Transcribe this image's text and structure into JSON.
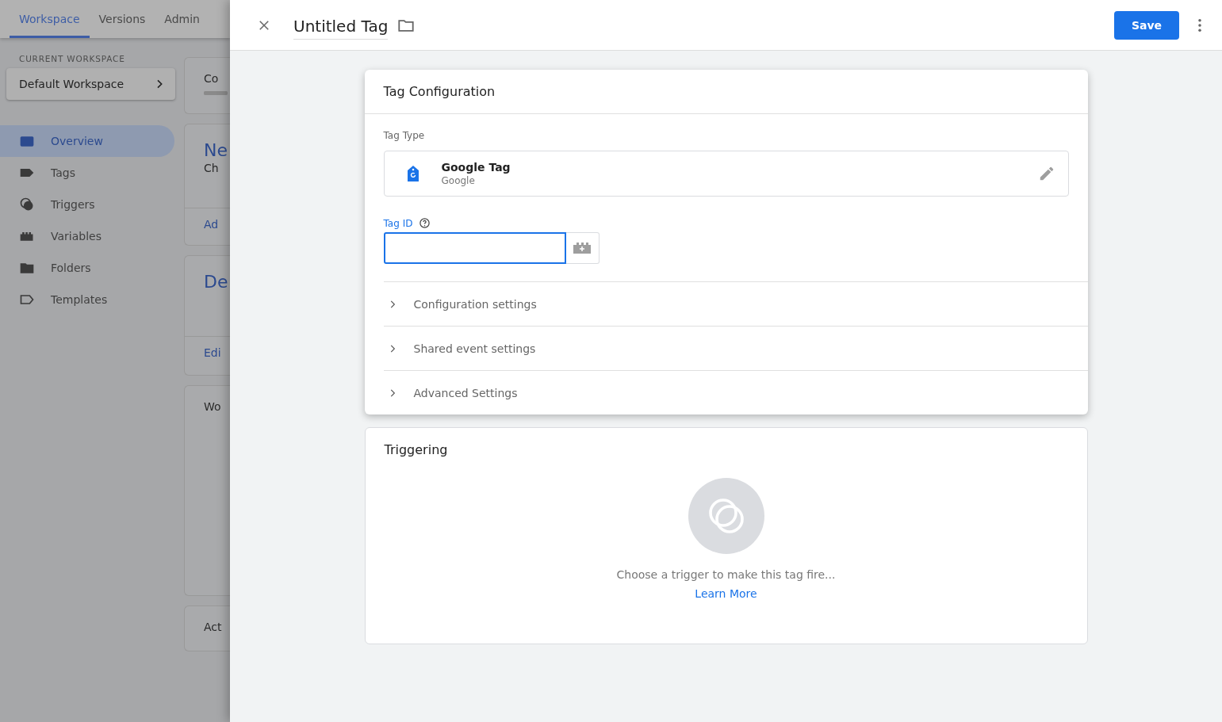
{
  "top_tabs": [
    {
      "label": "Workspace",
      "selected": true
    },
    {
      "label": "Versions",
      "selected": false
    },
    {
      "label": "Admin",
      "selected": false
    }
  ],
  "workspace": {
    "heading": "CURRENT WORKSPACE",
    "name": "Default Workspace"
  },
  "sidebar": {
    "items": [
      {
        "label": "Overview",
        "selected": true
      },
      {
        "label": "Tags",
        "selected": false
      },
      {
        "label": "Triggers",
        "selected": false
      },
      {
        "label": "Variables",
        "selected": false
      },
      {
        "label": "Folders",
        "selected": false
      },
      {
        "label": "Templates",
        "selected": false
      }
    ]
  },
  "background_cards": [
    {
      "lines": [
        {
          "kind": "small",
          "text": "Co"
        },
        {
          "kind": "bar",
          "level": 1
        }
      ]
    },
    {
      "lines": [
        {
          "kind": "title",
          "text": "Ne"
        },
        {
          "kind": "small",
          "text": "Ch"
        },
        {
          "kind": "link",
          "text": "Ad"
        }
      ]
    },
    {
      "lines": [
        {
          "kind": "title",
          "text": "De"
        },
        {
          "kind": "link",
          "text": "Edi"
        }
      ]
    },
    {
      "lines": [
        {
          "kind": "small",
          "text": "Wo"
        }
      ]
    },
    {
      "lines": [
        {
          "kind": "small",
          "text": "Act"
        }
      ]
    }
  ],
  "panel": {
    "title": "Untitled Tag",
    "save_label": "Save"
  },
  "tag_configuration": {
    "title": "Tag Configuration",
    "tag_type_label": "Tag Type",
    "tag_type": {
      "name": "Google Tag",
      "vendor": "Google"
    },
    "tag_id": {
      "label": "Tag ID"
    },
    "sections": [
      {
        "label": "Configuration settings",
        "expanded": false
      },
      {
        "label": "Shared event settings",
        "expanded": false
      },
      {
        "label": "Advanced Settings",
        "expanded": false
      }
    ]
  },
  "triggering": {
    "title": "Triggering",
    "message": "Choose a trigger to make this tag fire...",
    "link": "Learn More"
  }
}
